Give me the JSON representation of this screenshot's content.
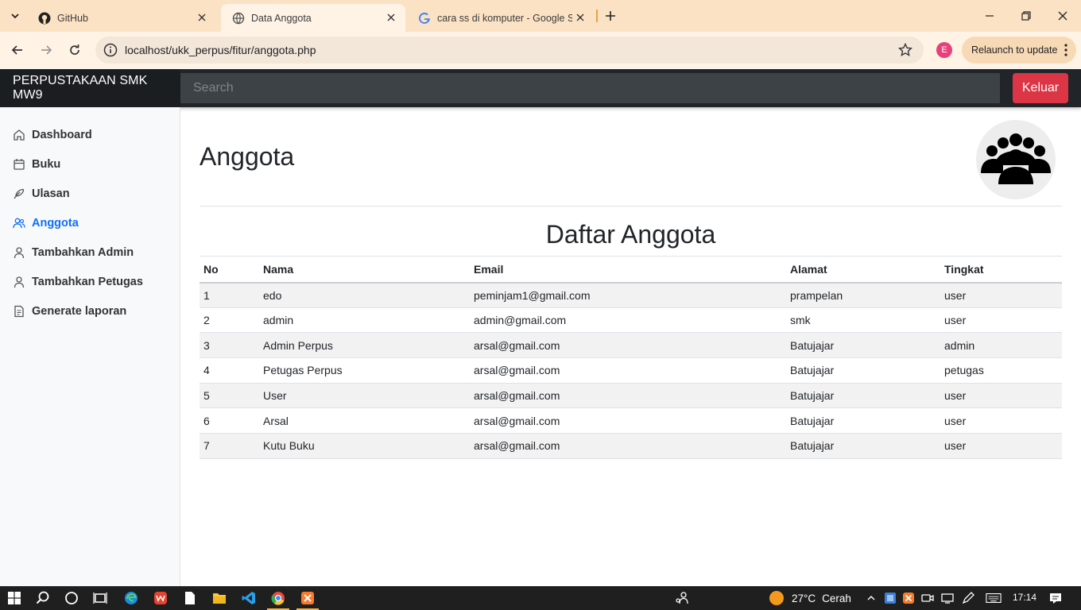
{
  "browser": {
    "tabs": [
      {
        "title": "GitHub",
        "icon": "github-icon"
      },
      {
        "title": "Data Anggota",
        "icon": "globe-icon"
      },
      {
        "title": "cara ss di komputer - Google Se",
        "icon": "google-icon"
      }
    ],
    "url": "localhost/ukk_perpus/fitur/anggota.php",
    "profile_initial": "E",
    "relaunch_label": "Relaunch to update"
  },
  "navbar": {
    "brand": "PERPUSTAKAAN SMK MW9",
    "search_placeholder": "Search",
    "logout_label": "Keluar",
    "logout_color": "#dc3545"
  },
  "sidebar": {
    "items": [
      {
        "label": "Dashboard",
        "icon": "home-icon"
      },
      {
        "label": "Buku",
        "icon": "calendar-icon"
      },
      {
        "label": "Ulasan",
        "icon": "feather-icon"
      },
      {
        "label": "Anggota",
        "icon": "users-icon",
        "active": true
      },
      {
        "label": "Tambahkan Admin",
        "icon": "user-icon"
      },
      {
        "label": "Tambahkan Petugas",
        "icon": "user-icon"
      },
      {
        "label": "Generate laporan",
        "icon": "file-icon"
      }
    ],
    "active_color": "#0d6efd"
  },
  "main": {
    "title": "Anggota",
    "section_title": "Daftar Anggota",
    "columns": [
      "No",
      "Nama",
      "Email",
      "Alamat",
      "Tingkat"
    ],
    "rows": [
      [
        "1",
        "edo",
        "peminjam1@gmail.com",
        "prampelan",
        "user"
      ],
      [
        "2",
        "admin",
        "admin@gmail.com",
        "smk",
        "user"
      ],
      [
        "3",
        "Admin Perpus",
        "arsal@gmail.com",
        "Batujajar",
        "admin"
      ],
      [
        "4",
        "Petugas Perpus",
        "arsal@gmail.com",
        "Batujajar",
        "petugas"
      ],
      [
        "5",
        "User",
        "arsal@gmail.com",
        "Batujajar",
        "user"
      ],
      [
        "6",
        "Arsal",
        "arsal@gmail.com",
        "Batujajar",
        "user"
      ],
      [
        "7",
        "Kutu Buku",
        "arsal@gmail.com",
        "Batujajar",
        "user"
      ]
    ]
  },
  "taskbar": {
    "temperature": "27°C",
    "weather": "Cerah",
    "time": "17:14"
  }
}
